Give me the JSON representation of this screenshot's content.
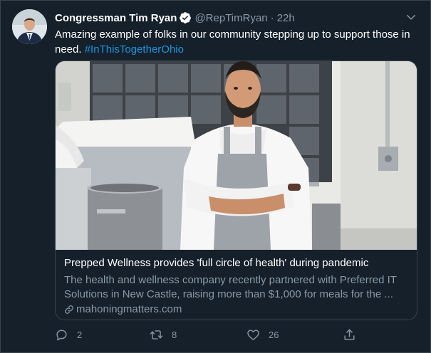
{
  "author": {
    "display_name": "Congressman Tim Ryan",
    "handle": "@RepTimRyan",
    "separator": "·",
    "time": "22h"
  },
  "tweet": {
    "text": "Amazing example of folks in our community stepping up to support those in need.",
    "hashtag": "#InThisTogetherOhio"
  },
  "card": {
    "title": "Prepped Wellness provides 'full circle of health' during pandemic",
    "description": "The health and wellness company recently partnered with Preferred IT Solutions in New Castle, raising more than $1,000 for meals for the ...",
    "domain": "mahoningmatters.com"
  },
  "actions": {
    "reply_count": "2",
    "retweet_count": "8",
    "like_count": "26"
  },
  "colors": {
    "background": "#15202b",
    "border": "#38444d",
    "secondary_text": "#8899a6",
    "link": "#1b95e0"
  },
  "icons": [
    "verified-badge-icon",
    "chevron-down-icon",
    "link-icon",
    "reply-icon",
    "retweet-icon",
    "like-icon",
    "share-icon"
  ]
}
